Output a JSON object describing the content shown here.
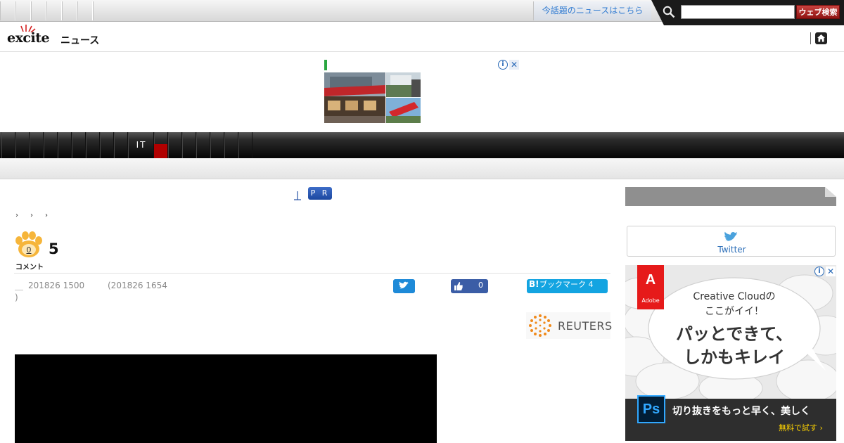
{
  "topbar": {
    "trend_link": "今話題のニュースはこちら",
    "search": {
      "value": "",
      "button_label": "ウェブ検索"
    }
  },
  "header": {
    "logo_text": "excite",
    "logo_suffix": "ニュース"
  },
  "ad_banner": {
    "info_glyph": "i",
    "close_glyph": "✕"
  },
  "category_nav": {
    "items": [
      "",
      "",
      "",
      "",
      "",
      "",
      "",
      "",
      "",
      "IT",
      "",
      "",
      "",
      "",
      "",
      "",
      ""
    ],
    "active_index": 10
  },
  "article": {
    "pr_badge": "P R",
    "breadcrumb": [
      "›",
      "›",
      "›"
    ],
    "comments": {
      "paw_count": "0",
      "label": "コメント",
      "number": "5"
    },
    "published": "201826 1500",
    "updated": "(201826 1654",
    "date_prefix": "＿",
    "date_closing": ")",
    "share": {
      "like_count": "0",
      "hatena_b": "B!",
      "hatena_label": "ブックマーク 4"
    },
    "source_logo": "REUTERS"
  },
  "sidebar": {
    "twitter_label": "Twitter",
    "ad": {
      "info_glyph": "i",
      "close_glyph": "✕",
      "brand_glyph": "A",
      "brand_name": "Adobe",
      "bubble_line1": "Creative Cloudの",
      "bubble_line2": "ここがイイ！",
      "bubble_line3": "パッとできて、",
      "bubble_line4": "しかもキレイ",
      "app_icon": "Ps",
      "tagline": "切り抜きをもっと早く、美しく",
      "cta": "無料で試す ›"
    }
  },
  "colors": {
    "link_blue": "#2f7ad1",
    "search_red": "#a5201e",
    "nav_active_red": "#b10000",
    "twitter_blue": "#1e8ad8",
    "facebook_blue": "#3b5da6",
    "hatena_blue": "#13a4e1",
    "adobe_red": "#e61a1a"
  },
  "icons": [
    "search-icon",
    "home-icon",
    "paw-icon",
    "twitter-bird-icon",
    "thumbs-up-icon",
    "info-icon",
    "close-icon",
    "reuters-icon"
  ]
}
